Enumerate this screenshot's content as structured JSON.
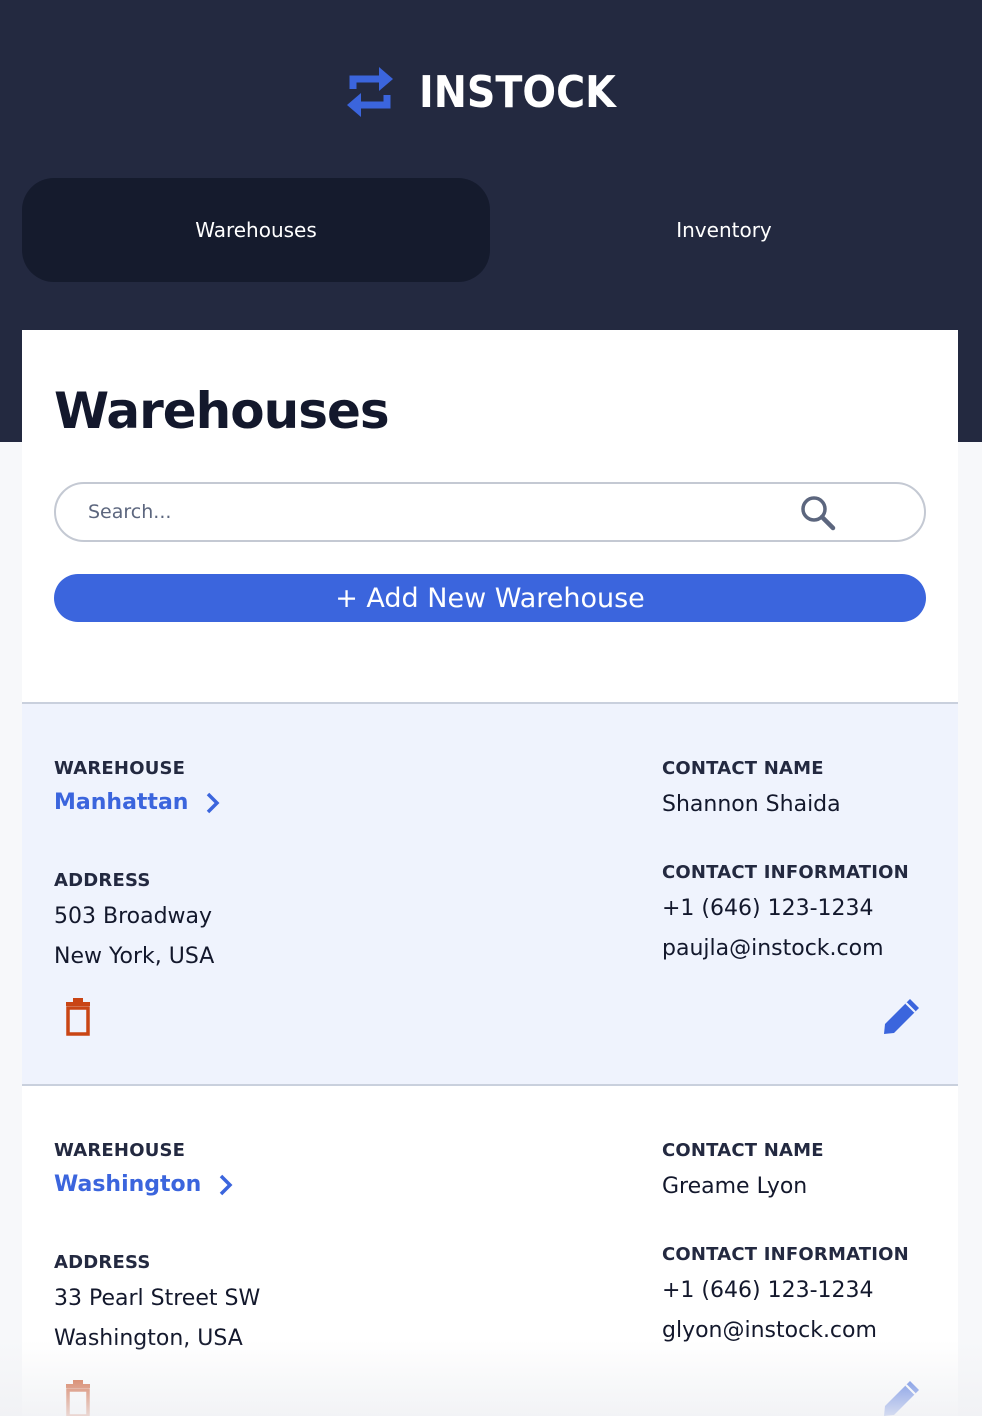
{
  "app": {
    "name": "INSTOCK",
    "logo_icon": "swap-arrows-icon"
  },
  "nav": {
    "tabs": [
      {
        "label": "Warehouses",
        "active": true
      },
      {
        "label": "Inventory",
        "active": false
      }
    ]
  },
  "page": {
    "title": "Warehouses",
    "search_placeholder": "Search...",
    "add_label": "+ Add New Warehouse"
  },
  "labels": {
    "warehouse": "WAREHOUSE",
    "address": "ADDRESS",
    "contact_name": "CONTACT NAME",
    "contact_info": "CONTACT INFORMATION"
  },
  "warehouses": [
    {
      "name": "Manhattan",
      "address_line1": "503 Broadway",
      "address_line2": "New York, USA",
      "contact_name": "Shannon Shaida",
      "phone": "+1 (646) 123-1234",
      "email": "paujla@instock.com"
    },
    {
      "name": "Washington",
      "address_line1": "33 Pearl Street SW",
      "address_line2": "Washington, USA",
      "contact_name": "Greame Lyon",
      "phone": "+1 (646) 123-1234",
      "email": "glyon@instock.com"
    }
  ],
  "colors": {
    "header_bg": "#232940",
    "active_tab": "#151b2d",
    "accent": "#3b65dd",
    "delete": "#c94515",
    "row_highlight": "#eff3fd"
  }
}
